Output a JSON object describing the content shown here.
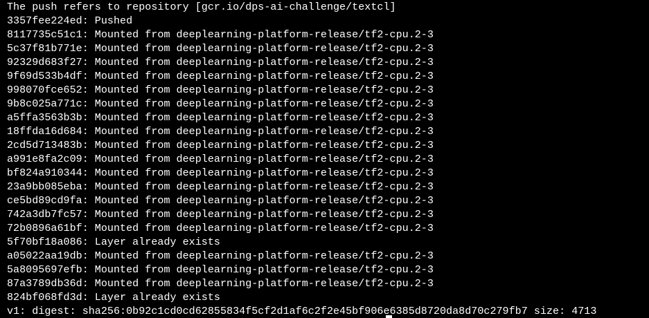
{
  "terminal": {
    "lines": [
      "The push refers to repository [gcr.io/dps-ai-challenge/textcl]",
      "3357fee224ed: Pushed",
      "8117735c51c1: Mounted from deeplearning-platform-release/tf2-cpu.2-3",
      "5c37f81b771e: Mounted from deeplearning-platform-release/tf2-cpu.2-3",
      "92329d683f27: Mounted from deeplearning-platform-release/tf2-cpu.2-3",
      "9f69d533b4df: Mounted from deeplearning-platform-release/tf2-cpu.2-3",
      "998070fce652: Mounted from deeplearning-platform-release/tf2-cpu.2-3",
      "9b8c025a771c: Mounted from deeplearning-platform-release/tf2-cpu.2-3",
      "a5ffa3563b3b: Mounted from deeplearning-platform-release/tf2-cpu.2-3",
      "18ffda16d684: Mounted from deeplearning-platform-release/tf2-cpu.2-3",
      "2cd5d713483b: Mounted from deeplearning-platform-release/tf2-cpu.2-3",
      "a991e8fa2c09: Mounted from deeplearning-platform-release/tf2-cpu.2-3",
      "bf824a910344: Mounted from deeplearning-platform-release/tf2-cpu.2-3",
      "23a9bb085eba: Mounted from deeplearning-platform-release/tf2-cpu.2-3",
      "ce5bd89cd9fa: Mounted from deeplearning-platform-release/tf2-cpu.2-3",
      "742a3db7fc57: Mounted from deeplearning-platform-release/tf2-cpu.2-3",
      "72b0896a61bf: Mounted from deeplearning-platform-release/tf2-cpu.2-3",
      "5f70bf18a086: Layer already exists",
      "a05022aa19db: Mounted from deeplearning-platform-release/tf2-cpu.2-3",
      "5a8095697efb: Mounted from deeplearning-platform-release/tf2-cpu.2-3",
      "87a3789db36d: Mounted from deeplearning-platform-release/tf2-cpu.2-3",
      "824bf068fd3d: Layer already exists",
      "v1: digest: sha256:0b92c1cd0cd62855834f5cf2d1af6c2f2e45bf906e6385d8720da8d70c279fb7 size: 4713"
    ]
  },
  "colors": {
    "background": "#000000",
    "text": "#ffffff"
  }
}
